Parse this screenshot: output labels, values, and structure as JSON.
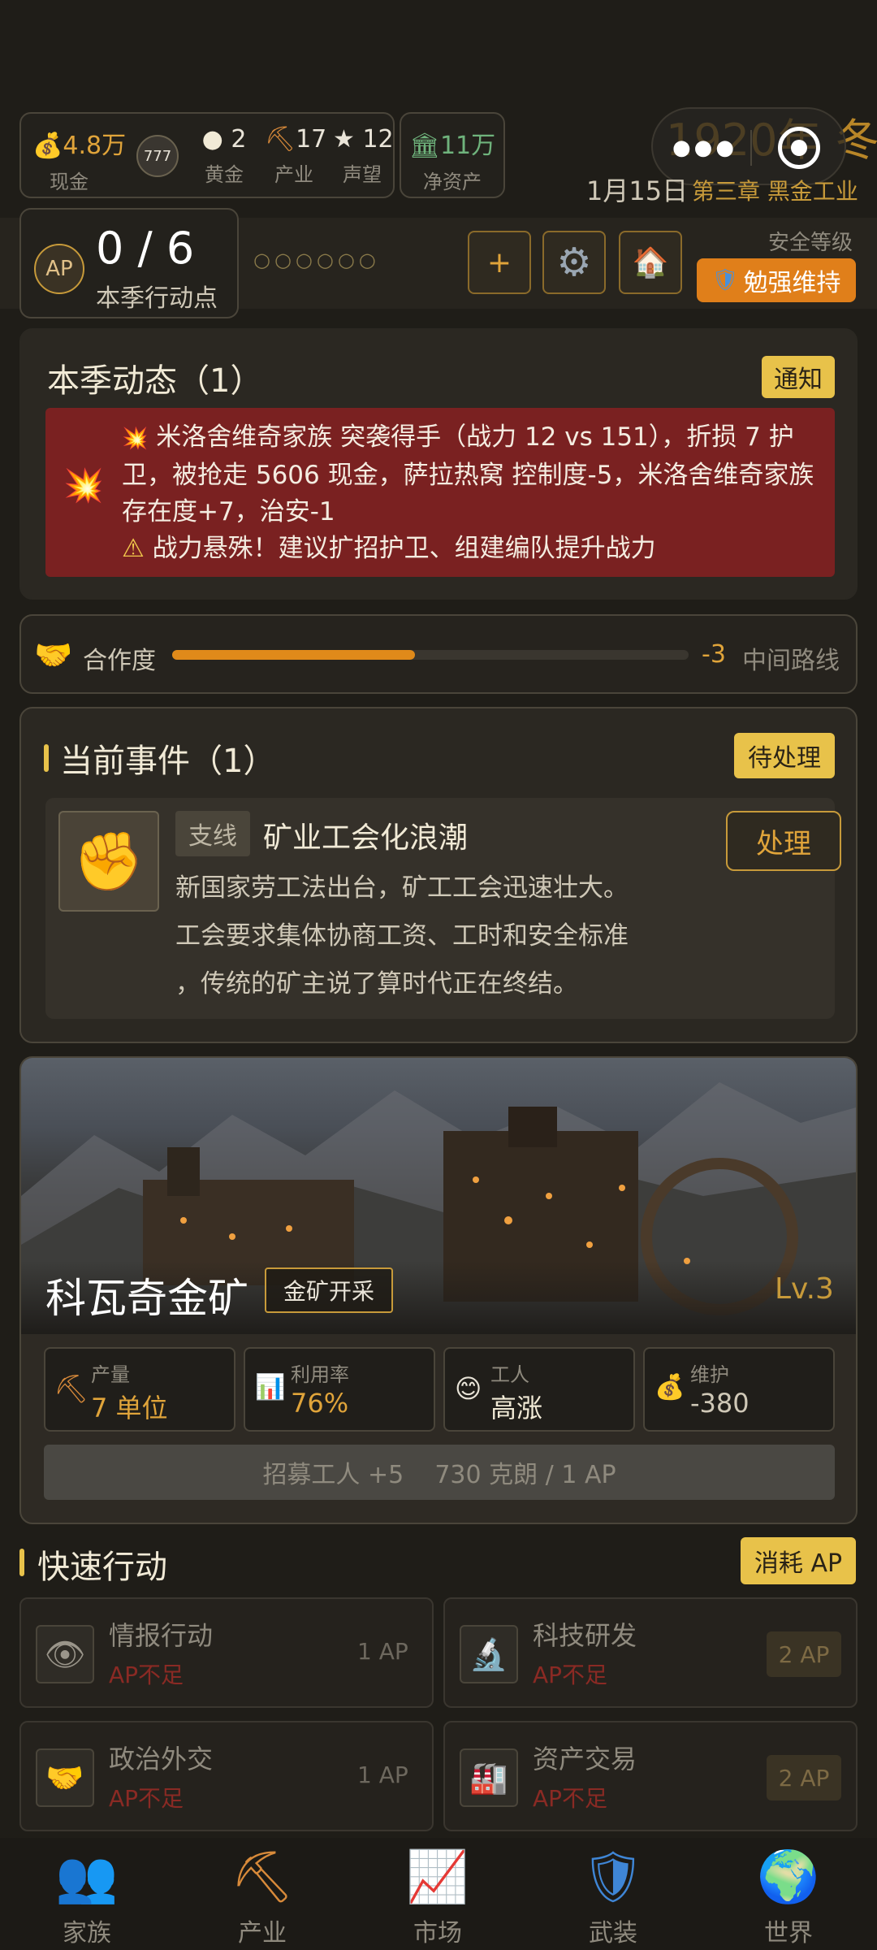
{
  "top": {
    "cash_value": "4.8万",
    "cash_label": "现金",
    "gold_value": "2",
    "gold_label": "黄金",
    "industry_value": "17",
    "industry_label": "产业",
    "reputation_value": "12",
    "reputation_label": "声望",
    "networth_value": "11万",
    "networth_label": "净资产",
    "year_season": "1920年 冬",
    "date": "1月15日",
    "chapter": "第三章 黑金工业"
  },
  "ap": {
    "badge": "AP",
    "value": "0 / 6",
    "label": "本季行动点",
    "dots": [
      "○",
      "○",
      "○",
      "○",
      "○",
      "○"
    ],
    "add_label": "+",
    "security_label": "安全等级",
    "security_value": "勉强维持"
  },
  "season": {
    "title": "本季动态（1）",
    "badge": "通知",
    "alert_line1": "米洛舍维奇家族 突袭得手（战力 12 vs 151），折损 7 护卫，被抢走 5606 现金，萨拉热窝 控制度-5，米洛舍维奇家族存在度+7，治安-1",
    "alert_line2": "战力悬殊！建议扩招护卫、组建编队提升战力"
  },
  "coop": {
    "label": "合作度",
    "value_text": "-3",
    "fill": 0.47,
    "route": "中间路线"
  },
  "events": {
    "title": "当前事件（1）",
    "badge": "待处理",
    "tag": "支线",
    "name": "矿业工会化浪潮",
    "desc_line1": "新国家劳工法出台，矿工工会迅速壮大。",
    "desc_line2": "工会要求集体协商工资、工时和安全标准",
    "desc_line3": "，传统的矿主说了算时代正在终结。",
    "action": "处理"
  },
  "mine": {
    "name": "科瓦奇金矿",
    "type": "金矿开采",
    "level": "Lv.3",
    "stats": [
      {
        "label": "产量",
        "value": "7 单位",
        "icon": "pickaxe-icon"
      },
      {
        "label": "利用率",
        "value": "76%",
        "icon": "bar-chart-icon"
      },
      {
        "label": "工人",
        "value": "高涨",
        "icon": "smile-icon"
      },
      {
        "label": "维护",
        "value": "-380",
        "icon": "money-bag-icon"
      }
    ],
    "recruit": "招募工人 +5    730 克朗 / 1 AP"
  },
  "quick": {
    "title": "快速行动",
    "badge": "消耗 AP",
    "actions": [
      {
        "name": "情报行动",
        "status": "AP不足",
        "cost": "1 AP",
        "icon": "eye-icon"
      },
      {
        "name": "科技研发",
        "status": "AP不足",
        "cost": "2 AP",
        "icon": "microscope-icon"
      },
      {
        "name": "政治外交",
        "status": "AP不足",
        "cost": "1 AP",
        "icon": "handshake-icon"
      },
      {
        "name": "资产交易",
        "status": "AP不足",
        "cost": "2 AP",
        "icon": "factory-icon"
      }
    ]
  },
  "nav": [
    {
      "label": "家族",
      "icon": "family-icon"
    },
    {
      "label": "产业",
      "icon": "pickaxe-icon"
    },
    {
      "label": "市场",
      "icon": "chart-icon"
    },
    {
      "label": "武装",
      "icon": "shield-icon"
    },
    {
      "label": "世界",
      "icon": "globe-icon"
    }
  ],
  "colors": {
    "accent": "#e0a43a",
    "badge": "#e8c24a",
    "alert_bg": "#7a2121",
    "danger": "#c0392b"
  }
}
